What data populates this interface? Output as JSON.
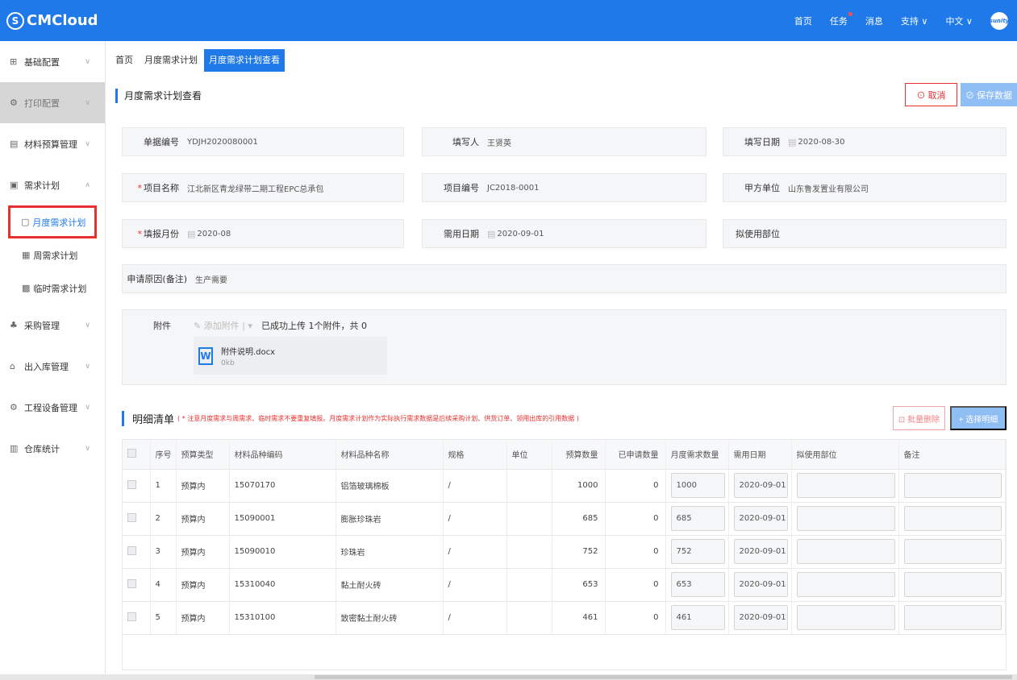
{
  "app": {
    "brand": "CMCloud",
    "brand_mark": "S"
  },
  "topnav": {
    "home": "首页",
    "tasks": "任务",
    "messages": "消息",
    "support": "支持 ∨",
    "language": "中文 ∨",
    "avatar": "sunity"
  },
  "sidebar": {
    "items": [
      {
        "label": "基础配置",
        "icon": "grid-icon",
        "glyph": "⊞",
        "arrow": "∨"
      },
      {
        "label": "打印配置",
        "icon": "settings-icon",
        "glyph": "⚙",
        "arrow": "∨"
      },
      {
        "label": "材料预算管理",
        "icon": "budget-icon",
        "glyph": "▤",
        "arrow": "∨"
      },
      {
        "label": "需求计划",
        "icon": "plan-icon",
        "glyph": "▣",
        "arrow": "∧"
      }
    ],
    "subitems": [
      {
        "label": "月度需求计划",
        "glyph": "▢"
      },
      {
        "label": "周需求计划",
        "glyph": "▦"
      },
      {
        "label": "临时需求计划",
        "glyph": "▩"
      }
    ],
    "items2": [
      {
        "label": "采购管理",
        "glyph": "♣",
        "arrow": "∨"
      },
      {
        "label": "出入库管理",
        "glyph": "⌂",
        "arrow": "∨"
      },
      {
        "label": "工程设备管理",
        "glyph": "⚙",
        "arrow": "∨"
      },
      {
        "label": "仓库统计",
        "glyph": "▥",
        "arrow": "∨"
      }
    ]
  },
  "tabs": [
    "首页",
    "月度需求计划",
    "月度需求计划查看"
  ],
  "page": {
    "title": "月度需求计划查看",
    "cancel": "⊙ 取消",
    "save": "⊘ 保存数据"
  },
  "form": {
    "doc_no": {
      "label": "单据编号",
      "value": "YDJH2020080001"
    },
    "writer": {
      "label": "填写人",
      "value": "王贤英"
    },
    "write_date": {
      "label": "填写日期",
      "value": "2020-08-30"
    },
    "project_name": {
      "label": "项目名称",
      "value": "江北新区青龙绿带二期工程EPC总承包"
    },
    "project_no": {
      "label": "项目编号",
      "value": "JC2018-0001"
    },
    "party_a": {
      "label": "甲方单位",
      "value": "山东鲁发置业有限公司"
    },
    "report_month": {
      "label": "填报月份",
      "value": "2020-08"
    },
    "need_date": {
      "label": "需用日期",
      "value": "2020-09-01"
    },
    "use_dept": {
      "label": "拟使用部位",
      "value": ""
    },
    "reason": {
      "label": "申请原因(备注)",
      "value": "生产需要"
    },
    "required_mark": "*"
  },
  "attachment": {
    "label": "附件",
    "add": "✎ 添加附件 | ▾",
    "status": "已成功上传 1个附件，共 0",
    "file_name": "附件说明.docx",
    "file_size": "0kb",
    "file_icon": "W"
  },
  "detail": {
    "title": "明细清单",
    "note": "( * 注意月度需求与周需求、临时需求不要重复填报。月度需求计划作为实际执行需求数据是后续采购计划、供货订单、领用出库的引用数据 )",
    "batch_delete": "⊡ 批量删除",
    "choose": "+ 选择明细",
    "columns": [
      "",
      "序号",
      "预算类型",
      "材料品种编码",
      "材料品种名称",
      "规格",
      "单位",
      "预算数量",
      "已申请数量",
      "月度需求数量",
      "需用日期",
      "拟使用部位",
      "备注"
    ],
    "rows": [
      {
        "no": "1",
        "type": "预算内",
        "code": "15070170",
        "name": "铝箔玻璃棉板",
        "spec": "/",
        "unit": "",
        "budget": "1000",
        "applied": "0",
        "monthly": "1000",
        "date": "2020-09-01"
      },
      {
        "no": "2",
        "type": "预算内",
        "code": "15090001",
        "name": "膨胀珍珠岩",
        "spec": "/",
        "unit": "",
        "budget": "685",
        "applied": "0",
        "monthly": "685",
        "date": "2020-09-01"
      },
      {
        "no": "3",
        "type": "预算内",
        "code": "15090010",
        "name": "珍珠岩",
        "spec": "/",
        "unit": "",
        "budget": "752",
        "applied": "0",
        "monthly": "752",
        "date": "2020-09-01"
      },
      {
        "no": "4",
        "type": "预算内",
        "code": "15310040",
        "name": "黏土耐火砖",
        "spec": "/",
        "unit": "",
        "budget": "653",
        "applied": "0",
        "monthly": "653",
        "date": "2020-09-01"
      },
      {
        "no": "5",
        "type": "预算内",
        "code": "15310100",
        "name": "致密黏土耐火砖",
        "spec": "/",
        "unit": "",
        "budget": "461",
        "applied": "0",
        "monthly": "461",
        "date": "2020-09-01"
      }
    ]
  }
}
